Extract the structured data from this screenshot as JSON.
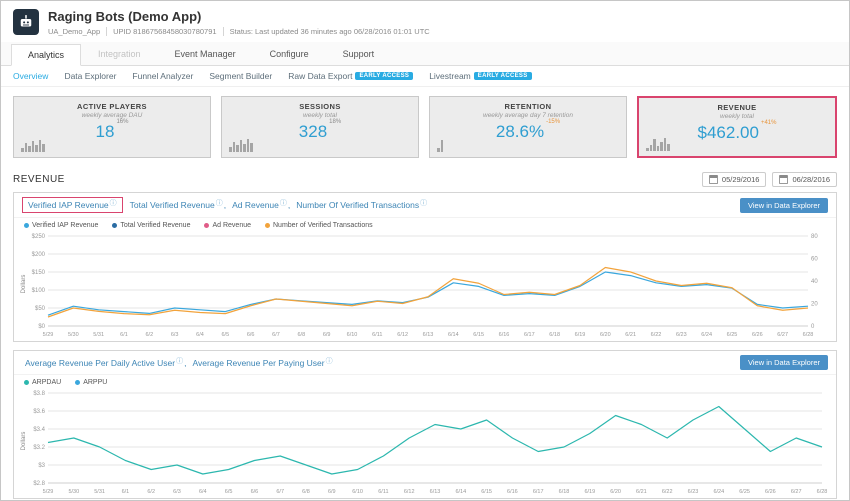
{
  "theme": {
    "accent_blue": "#2f9ed1",
    "link_blue": "#3d85b5",
    "highlight_pink": "#d9446e",
    "button_blue": "#4a90c7",
    "badge_blue": "#29abe2",
    "warn_orange": "#e8953c"
  },
  "icons": {
    "info": "ⓘ"
  },
  "app": {
    "title": "Raging Bots (Demo App)",
    "short_name": "UA_Demo_App",
    "upid": "UPID 81867568458030780791",
    "status": "Status: Last updated 36 minutes ago 06/28/2016 01:01 UTC"
  },
  "nav": {
    "tabs": [
      {
        "label": "Analytics"
      },
      {
        "label": "Integration"
      },
      {
        "label": "Event Manager"
      },
      {
        "label": "Configure"
      },
      {
        "label": "Support"
      }
    ],
    "subnav": [
      {
        "label": "Overview"
      },
      {
        "label": "Data Explorer"
      },
      {
        "label": "Funnel Analyzer"
      },
      {
        "label": "Segment Builder"
      },
      {
        "label": "Raw Data Export",
        "badge": "EARLY ACCESS"
      },
      {
        "label": "Livestream",
        "badge": "EARLY ACCESS"
      }
    ]
  },
  "kpis": [
    {
      "title": "ACTIVE PLAYERS",
      "subtitle": "weekly average DAU",
      "value": "18",
      "delta": "16%",
      "spark": [
        4,
        9,
        6,
        11,
        7,
        12,
        8
      ]
    },
    {
      "title": "SESSIONS",
      "subtitle": "weekly total",
      "value": "328",
      "delta": "18%",
      "spark": [
        5,
        10,
        7,
        12,
        8,
        13,
        9
      ]
    },
    {
      "title": "RETENTION",
      "subtitle": "weekly average day 7 retention",
      "value": "28.6%",
      "delta": "-15%",
      "spark": [
        4,
        12
      ]
    },
    {
      "title": "REVENUE",
      "subtitle": "weekly total",
      "value": "$462.00",
      "delta": "+41%",
      "spark": [
        3,
        6,
        12,
        5,
        9,
        13,
        7
      ]
    }
  ],
  "section": {
    "title": "REVENUE",
    "date_from": "05/29/2016",
    "date_to": "06/28/2016"
  },
  "panel1": {
    "metrics": [
      {
        "label": "Verified IAP Revenue"
      },
      {
        "label": "Total Verified Revenue"
      },
      {
        "label": "Ad Revenue"
      },
      {
        "label": "Number Of Verified Transactions"
      }
    ],
    "button": "View in Data Explorer",
    "legend": [
      {
        "label": "Verified IAP Revenue",
        "color": "#3aa7dd"
      },
      {
        "label": "Total Verified Revenue",
        "color": "#2b6ca3"
      },
      {
        "label": "Ad Revenue",
        "color": "#e05c88"
      },
      {
        "label": "Number of Verified Transactions",
        "color": "#f2a33c"
      }
    ]
  },
  "panel2": {
    "metrics": [
      {
        "label": "Average Revenue Per Daily Active User"
      },
      {
        "label": "Average Revenue Per Paying User"
      }
    ],
    "button": "View in Data Explorer",
    "legend": [
      {
        "label": "ARPDAU",
        "color": "#2cb7ae"
      },
      {
        "label": "ARPPU",
        "color": "#3aa7dd"
      }
    ]
  },
  "chart_data": [
    {
      "type": "line",
      "title": "Verified IAP Revenue",
      "ylabel": "Dollars",
      "grid": true,
      "legend_position": "top-left",
      "x": [
        "5/29",
        "5/30",
        "5/31",
        "6/1",
        "6/2",
        "6/3",
        "6/4",
        "6/5",
        "6/6",
        "6/7",
        "6/8",
        "6/9",
        "6/10",
        "6/11",
        "6/12",
        "6/13",
        "6/14",
        "6/15",
        "6/16",
        "6/17",
        "6/18",
        "6/19",
        "6/20",
        "6/21",
        "6/22",
        "6/23",
        "6/24",
        "6/25",
        "6/26",
        "6/27",
        "6/28"
      ],
      "left_axis": {
        "labels": [
          "$0",
          "$50",
          "$100",
          "$150",
          "$200",
          "$250"
        ],
        "values": [
          0,
          50,
          100,
          150,
          200,
          250
        ],
        "min": 0,
        "max": 250
      },
      "right_axis": {
        "labels": [
          "0",
          "20",
          "40",
          "60",
          "80"
        ],
        "values": [
          0,
          20,
          40,
          60,
          80
        ],
        "min": 0,
        "max": 80
      },
      "series": [
        {
          "name": "Verified IAP Revenue",
          "axis": "left",
          "color": "#3aa7dd",
          "values": [
            30,
            55,
            45,
            40,
            35,
            50,
            45,
            40,
            60,
            75,
            70,
            65,
            60,
            70,
            65,
            80,
            120,
            110,
            85,
            90,
            85,
            110,
            150,
            140,
            120,
            110,
            115,
            105,
            60,
            50,
            55
          ]
        },
        {
          "name": "Number of Verified Transactions",
          "axis": "right",
          "color": "#f2a33c",
          "values": [
            8,
            16,
            13,
            11,
            10,
            14,
            12,
            11,
            18,
            24,
            22,
            20,
            18,
            22,
            20,
            26,
            42,
            38,
            28,
            30,
            28,
            36,
            52,
            48,
            40,
            36,
            38,
            34,
            18,
            14,
            16
          ]
        }
      ]
    },
    {
      "type": "line",
      "title": "Average Revenue Per Daily Active User",
      "ylabel": "Dollars",
      "grid": true,
      "legend_position": "top-left",
      "x": [
        "5/29",
        "5/30",
        "5/31",
        "6/1",
        "6/2",
        "6/3",
        "6/4",
        "6/5",
        "6/6",
        "6/7",
        "6/8",
        "6/9",
        "6/10",
        "6/11",
        "6/12",
        "6/13",
        "6/14",
        "6/15",
        "6/16",
        "6/17",
        "6/18",
        "6/19",
        "6/20",
        "6/21",
        "6/22",
        "6/23",
        "6/24",
        "6/25",
        "6/26",
        "6/27",
        "6/28"
      ],
      "left_axis": {
        "labels": [
          "$2.8",
          "$3",
          "$3.2",
          "$3.4",
          "$3.6",
          "$3.8"
        ],
        "values": [
          2.8,
          3.0,
          3.2,
          3.4,
          3.6,
          3.8
        ],
        "min": 2.8,
        "max": 3.8
      },
      "series": [
        {
          "name": "ARPDAU",
          "axis": "left",
          "color": "#2cb7ae",
          "values": [
            3.25,
            3.3,
            3.2,
            3.05,
            2.95,
            3.0,
            2.9,
            2.95,
            3.05,
            3.1,
            3.0,
            2.9,
            2.95,
            3.1,
            3.3,
            3.45,
            3.4,
            3.5,
            3.3,
            3.15,
            3.2,
            3.35,
            3.55,
            3.45,
            3.3,
            3.5,
            3.65,
            3.4,
            3.15,
            3.3,
            3.2
          ]
        }
      ]
    }
  ]
}
